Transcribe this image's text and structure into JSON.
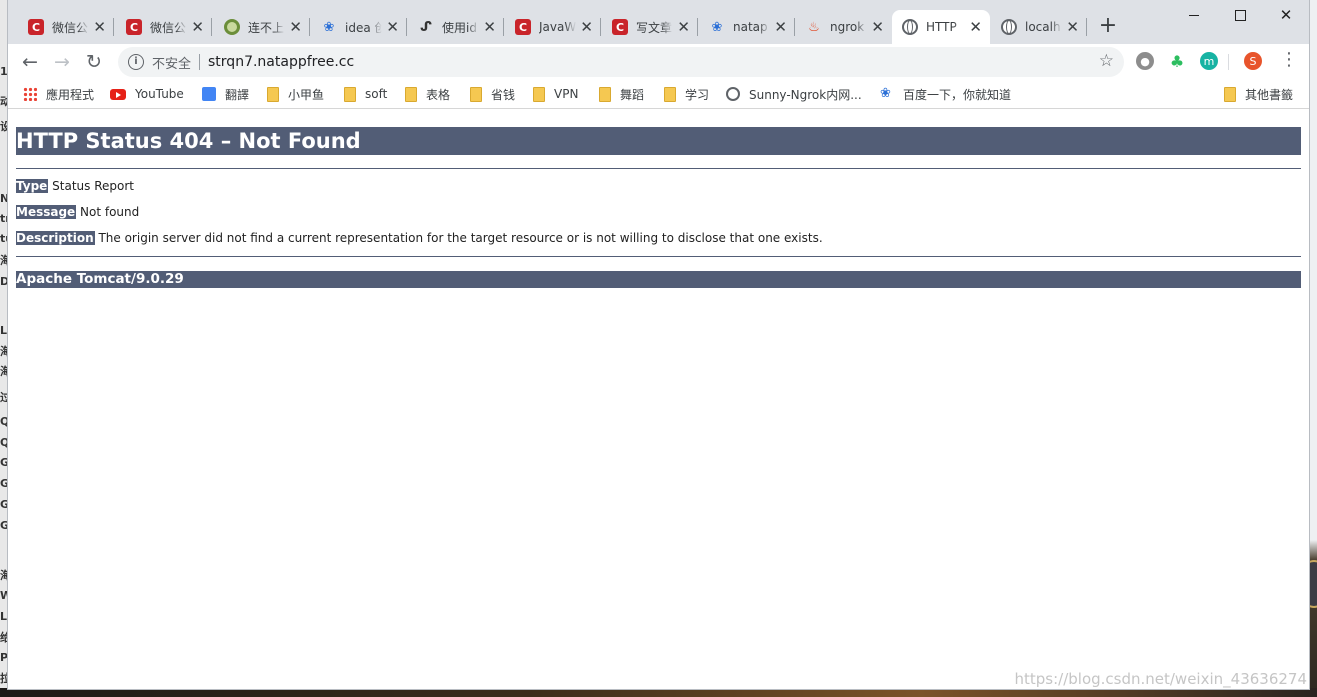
{
  "tabs": [
    {
      "title": "微信公",
      "icon": "csdn-icon"
    },
    {
      "title": "微信公",
      "icon": "csdn-icon"
    },
    {
      "title": "连不上",
      "icon": "ring-icon"
    },
    {
      "title": "idea 创",
      "icon": "baidu-paw-icon"
    },
    {
      "title": "使用id",
      "icon": "symbol-icon"
    },
    {
      "title": "JavaW",
      "icon": "csdn-icon"
    },
    {
      "title": "写文章",
      "icon": "csdn-icon"
    },
    {
      "title": "natap",
      "icon": "baidu-paw-icon"
    },
    {
      "title": "ngrok",
      "icon": "flame-icon"
    },
    {
      "title": "HTTP",
      "icon": "globe-icon",
      "active": true
    },
    {
      "title": "localh",
      "icon": "globe-icon"
    }
  ],
  "toolbar": {
    "security_label": "不安全",
    "url": "strqn7.natappfree.cc",
    "profile_initial": "S",
    "ext_m_label": "m"
  },
  "bookmarks": [
    {
      "label": "應用程式",
      "icon": "apps-icon"
    },
    {
      "label": "YouTube",
      "icon": "youtube-icon"
    },
    {
      "label": "翻譯",
      "icon": "translate-icon"
    },
    {
      "label": "小甲鱼",
      "icon": "folder-icon"
    },
    {
      "label": "soft",
      "icon": "folder-icon"
    },
    {
      "label": "表格",
      "icon": "folder-icon"
    },
    {
      "label": "省钱",
      "icon": "folder-icon"
    },
    {
      "label": "VPN",
      "icon": "folder-icon"
    },
    {
      "label": "舞蹈",
      "icon": "folder-icon"
    },
    {
      "label": "学习",
      "icon": "folder-icon"
    },
    {
      "label": "Sunny-Ngrok内网...",
      "icon": "globe-icon"
    },
    {
      "label": "百度一下，你就知道",
      "icon": "baidu-paw-icon"
    },
    {
      "label": "其他書籤",
      "icon": "folder-icon"
    }
  ],
  "page": {
    "heading": "HTTP Status 404 – Not Found",
    "type_label": "Type",
    "type_value": "Status Report",
    "message_label": "Message",
    "message_value": "Not found",
    "description_label": "Description",
    "description_value": "The origin server did not find a current representation for the target resource or is not willing to disclose that one exists.",
    "footer": "Apache Tomcat/9.0.29"
  },
  "watermark": "https://blog.csdn.net/weixin_43636274",
  "colors": {
    "tomcat_banner": "#525d76",
    "tab_strip": "#dee1e6",
    "csdn_red": "#c9242a"
  }
}
